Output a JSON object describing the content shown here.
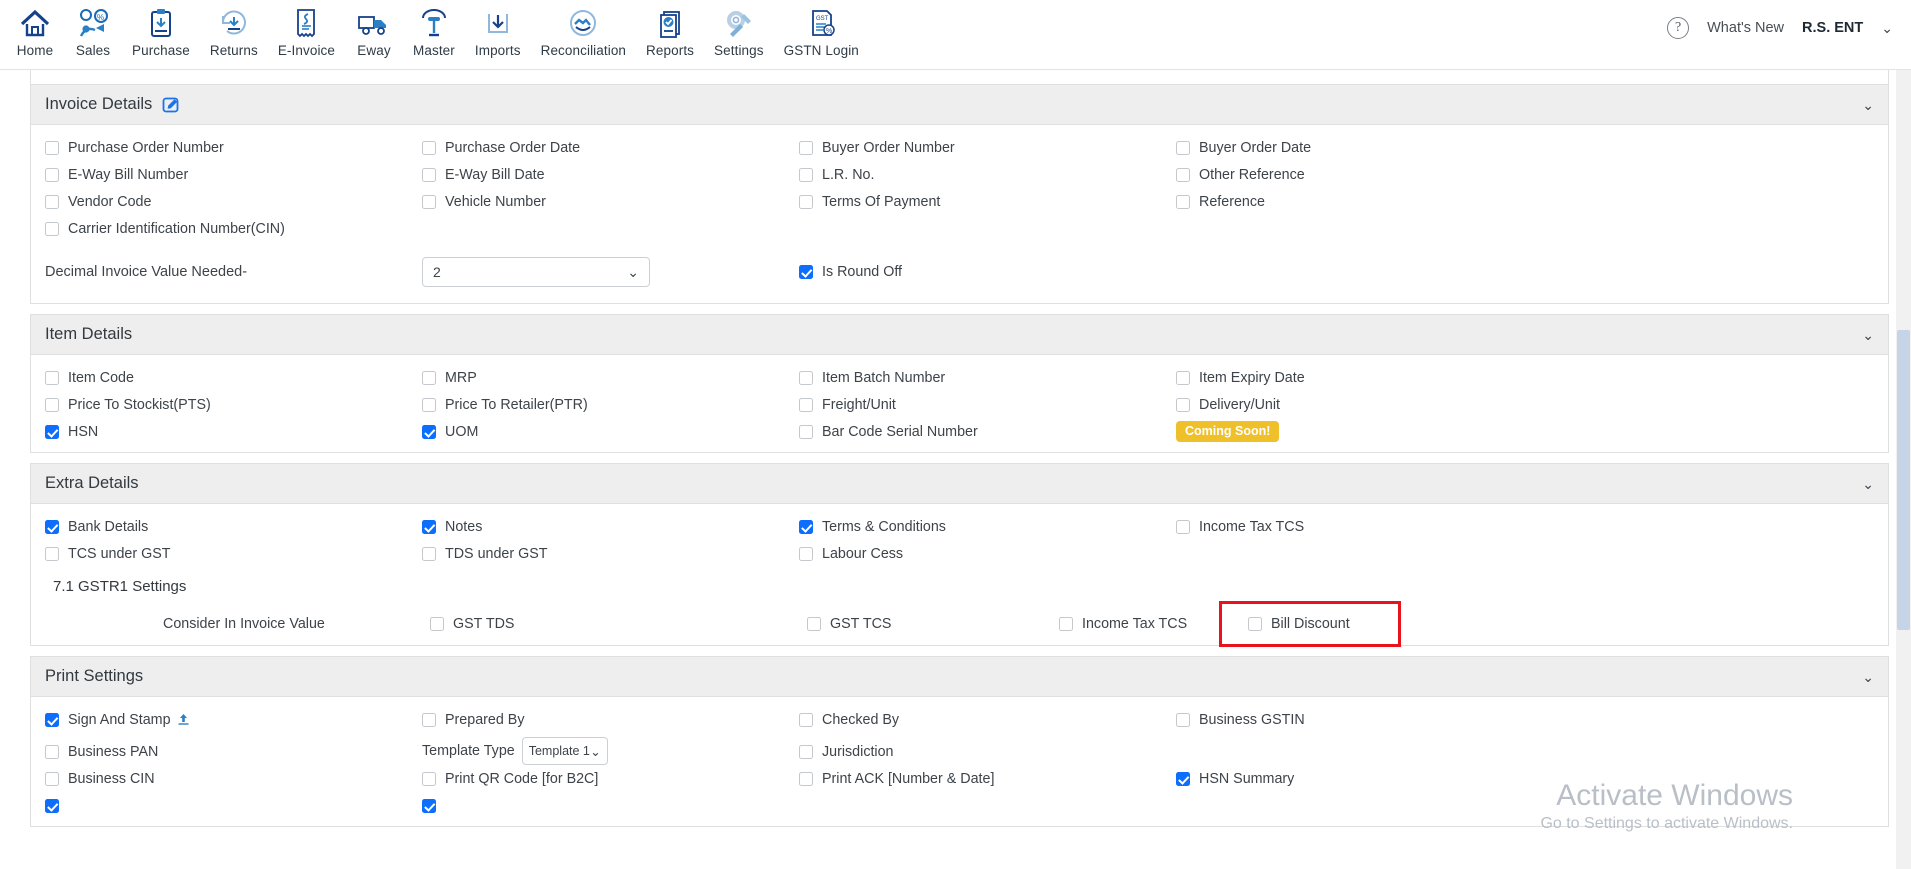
{
  "header": {
    "nav_items": [
      {
        "label": "Home",
        "icon": "home-icon"
      },
      {
        "label": "Sales",
        "icon": "sales-icon"
      },
      {
        "label": "Purchase",
        "icon": "purchase-icon"
      },
      {
        "label": "Returns",
        "icon": "returns-icon"
      },
      {
        "label": "E-Invoice",
        "icon": "einvoice-icon"
      },
      {
        "label": "Eway",
        "icon": "eway-truck-icon"
      },
      {
        "label": "Master",
        "icon": "master-icon"
      },
      {
        "label": "Imports",
        "icon": "imports-download-icon"
      },
      {
        "label": "Reconciliation",
        "icon": "reconciliation-icon"
      },
      {
        "label": "Reports",
        "icon": "reports-icon"
      },
      {
        "label": "Settings",
        "icon": "settings-gear-icon"
      },
      {
        "label": "GSTN Login",
        "icon": "gstn-login-icon"
      }
    ],
    "help_glyph": "?",
    "whats_new": "What's New",
    "user": "R.S. ENT",
    "user_chevron": "⌄"
  },
  "sections": {
    "invoice_details": {
      "title": "Invoice Details",
      "edit_icon": "edit-pencil-icon",
      "chevron": "⌄",
      "options": [
        {
          "label": "Purchase Order Number",
          "checked": false
        },
        {
          "label": "Purchase Order Date",
          "checked": false
        },
        {
          "label": "Buyer Order Number",
          "checked": false
        },
        {
          "label": "Buyer Order Date",
          "checked": false
        },
        {
          "label": "E-Way Bill Number",
          "checked": false
        },
        {
          "label": "E-Way Bill Date",
          "checked": false
        },
        {
          "label": "L.R. No.",
          "checked": false
        },
        {
          "label": "Other Reference",
          "checked": false
        },
        {
          "label": "Vendor Code",
          "checked": false
        },
        {
          "label": "Vehicle Number",
          "checked": false
        },
        {
          "label": "Terms Of Payment",
          "checked": false
        },
        {
          "label": "Reference",
          "checked": false
        },
        {
          "label": "Carrier Identification Number(CIN)",
          "checked": false
        },
        {
          "label": "",
          "checked": null
        },
        {
          "label": "",
          "checked": null
        },
        {
          "label": "",
          "checked": null
        }
      ],
      "decimal_label": "Decimal Invoice Value Needed-",
      "decimal_value": "2",
      "decimal_chevron": "⌄",
      "round_off_label": "Is Round Off",
      "round_off_checked": true
    },
    "item_details": {
      "title": "Item Details",
      "chevron": "⌄",
      "options": [
        {
          "label": "Item Code",
          "checked": false
        },
        {
          "label": "MRP",
          "checked": false
        },
        {
          "label": "Item Batch Number",
          "checked": false
        },
        {
          "label": "Item Expiry Date",
          "checked": false
        },
        {
          "label": "Price To Stockist(PTS)",
          "checked": false
        },
        {
          "label": "Price To Retailer(PTR)",
          "checked": false
        },
        {
          "label": "Freight/Unit",
          "checked": false
        },
        {
          "label": "Delivery/Unit",
          "checked": false
        },
        {
          "label": "HSN",
          "checked": true
        },
        {
          "label": "UOM",
          "checked": true
        },
        {
          "label": "Bar Code Serial Number",
          "checked": false
        }
      ],
      "coming_soon_badge": "Coming Soon!"
    },
    "extra_details": {
      "title": "Extra Details",
      "chevron": "⌄",
      "options": [
        {
          "label": "Bank Details",
          "checked": true
        },
        {
          "label": "Notes",
          "checked": true
        },
        {
          "label": "Terms & Conditions",
          "checked": true
        },
        {
          "label": "Income Tax TCS",
          "checked": false
        },
        {
          "label": "TCS under GST",
          "checked": false
        },
        {
          "label": "TDS under GST",
          "checked": false
        },
        {
          "label": "Labour Cess",
          "checked": false
        },
        {
          "label": "",
          "checked": null
        }
      ],
      "gstr1": {
        "title": "7.1 GSTR1 Settings",
        "consider_label": "Consider In Invoice Value",
        "options": [
          {
            "label": "GST TDS",
            "checked": false
          },
          {
            "label": "GST TCS",
            "checked": false
          },
          {
            "label": "Income Tax TCS",
            "checked": false
          }
        ],
        "highlighted": {
          "label": "Bill Discount",
          "checked": false,
          "outline_color": "#e8131b"
        }
      }
    },
    "print_settings": {
      "title": "Print Settings",
      "chevron": "⌄",
      "row1": [
        {
          "label": "Sign And Stamp",
          "checked": true,
          "icon": "upload-icon"
        },
        {
          "label": "Prepared By",
          "checked": false
        },
        {
          "label": "Checked By",
          "checked": false
        },
        {
          "label": "Business GSTIN",
          "checked": false
        }
      ],
      "row2_col1": {
        "label": "Business PAN",
        "checked": false
      },
      "row2_col2_label": "Template Type",
      "row2_col2_value": "Template 1",
      "row2_col2_chevron": "⌄",
      "row2_col3": {
        "label": "Jurisdiction",
        "checked": false
      },
      "row3": [
        {
          "label": "Business CIN",
          "checked": false
        },
        {
          "label": "Print QR Code [for B2C]",
          "checked": false
        },
        {
          "label": "Print ACK [Number & Date]",
          "checked": false
        },
        {
          "label": "HSN Summary",
          "checked": true
        }
      ]
    }
  },
  "watermark": {
    "line1": "Activate Windows",
    "line2": "Go to Settings to activate Windows."
  }
}
